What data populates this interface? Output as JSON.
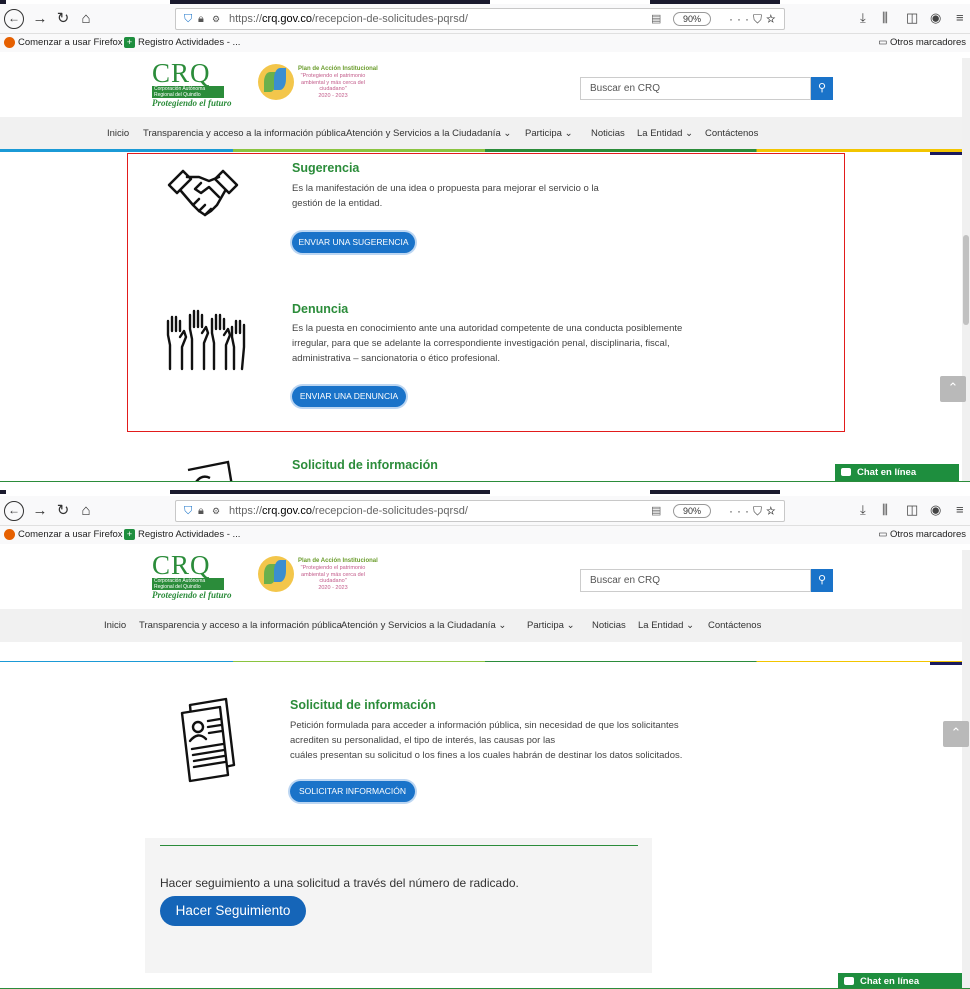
{
  "browser": {
    "url_prefix": "https://",
    "url_domain": "crq.gov.co",
    "url_path": "/recepcion-de-solicitudes-pqrsd/",
    "zoom": "90%",
    "bookmarks": [
      {
        "label": "Comenzar a usar Firefox"
      },
      {
        "label": "Registro Actividades - ..."
      }
    ],
    "other_bookmarks": "Otros marcadores"
  },
  "site": {
    "logo_text": "CRQ",
    "logo_band": "Corporación Autónoma Regional del Quindío",
    "logo_tagline": "Protegiendo el futuro",
    "plan_title": "Plan de Acción Institucional",
    "plan_text": "\"Protegiendo el patrimonio ambiental y más cerca del ciudadano\"",
    "plan_years": "2020 - 2023",
    "search_placeholder": "Buscar en CRQ",
    "nav": [
      {
        "label": "Inicio"
      },
      {
        "label": "Transparencia y acceso a la información pública"
      },
      {
        "label": "Atención y Servicios a la Ciudadanía ⌄"
      },
      {
        "label": "Participa ⌄"
      },
      {
        "label": "Noticias"
      },
      {
        "label": "La Entidad ⌄"
      },
      {
        "label": "Contáctenos"
      }
    ]
  },
  "sections": {
    "sugerencia": {
      "title": "Sugerencia",
      "desc": "Es la manifestación de una idea o propuesta para mejorar el servicio o la gestión de la entidad.",
      "button": "ENVIAR UNA SUGERENCIA"
    },
    "denuncia": {
      "title": "Denuncia",
      "desc": "Es la puesta en conocimiento ante una autoridad competente de una conducta posiblemente irregular, para que se adelante la correspondiente investigación penal, disciplinaria, fiscal, administrativa – sancionatoria o ético profesional.",
      "button": "ENVIAR UNA DENUNCIA"
    },
    "solicitud": {
      "title": "Solicitud de información",
      "desc_1": "Petición formulada para acceder a información pública, sin necesidad de que los solicitantes",
      "desc_2": "acrediten su personalidad, el tipo de interés, las causas por las",
      "desc_3": "cuáles presentan su solicitud o los fines a los cuales habrán de destinar los datos solicitados.",
      "button": "SOLICITAR INFORMACIÓN"
    }
  },
  "tracking": {
    "text": "Hacer seguimiento a una solicitud a través del número de radicado.",
    "button": "Hacer Seguimiento"
  },
  "chat": {
    "label": "Chat en línea"
  },
  "colors": {
    "brand_green": "#2b8c3a",
    "primary_blue": "#1a73c9",
    "highlight_red": "#e21b1b"
  }
}
